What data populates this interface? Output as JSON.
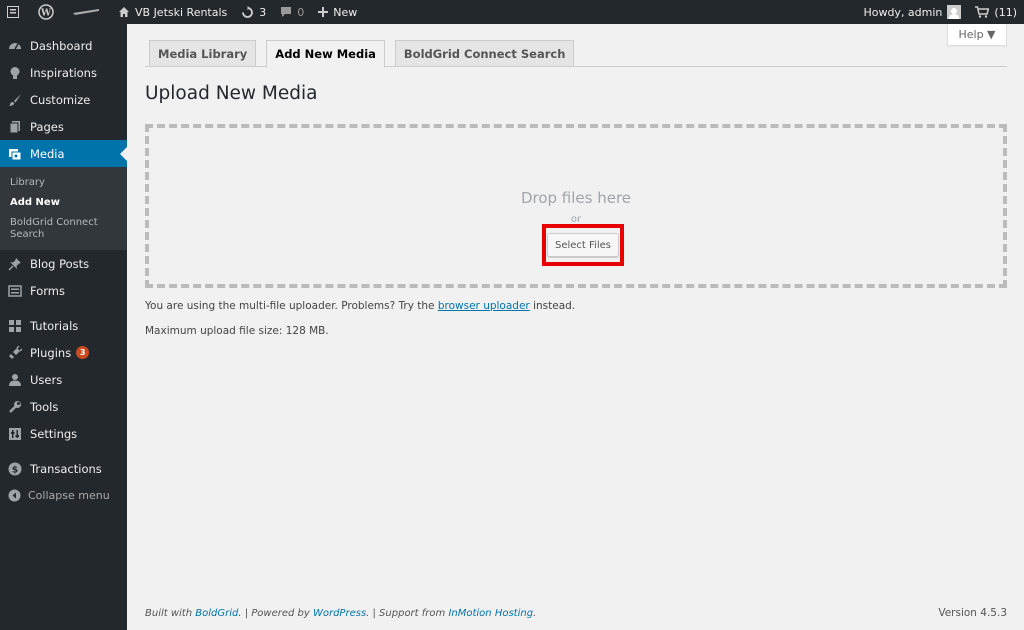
{
  "adminbar": {
    "site_name": "VB Jetski Rentals",
    "updates_count": "3",
    "comments_count": "0",
    "new_label": "New",
    "howdy": "Howdy, admin",
    "cart_count": "(11)"
  },
  "sidebar": {
    "items_top": [
      {
        "label": "Dashboard",
        "icon": "dashboard-icon"
      },
      {
        "label": "Inspirations",
        "icon": "lightbulb-icon"
      },
      {
        "label": "Customize",
        "icon": "brush-icon"
      },
      {
        "label": "Pages",
        "icon": "pages-icon"
      }
    ],
    "media_label": "Media",
    "submenu": [
      "Library",
      "Add New",
      "BoldGrid Connect Search"
    ],
    "items_mid": [
      {
        "label": "Blog Posts",
        "icon": "pushpin-icon"
      },
      {
        "label": "Forms",
        "icon": "forms-icon"
      }
    ],
    "tutorials": "Tutorials",
    "plugins": "Plugins",
    "plugins_badge": "3",
    "users": "Users",
    "tools": "Tools",
    "settings": "Settings",
    "transactions": "Transactions",
    "collapse": "Collapse menu"
  },
  "help_label": "Help ▼",
  "tabs": [
    "Media Library",
    "Add New Media",
    "BoldGrid Connect Search"
  ],
  "page_title": "Upload New Media",
  "dropzone": {
    "drop_text": "Drop files here",
    "or_text": "or",
    "select_button": "Select Files"
  },
  "uploader_note": {
    "before": "You are using the multi-file uploader. Problems? Try the ",
    "link": "browser uploader",
    "after": " instead."
  },
  "max_size": "Maximum upload file size: 128 MB.",
  "footer": {
    "built_with": "Built with ",
    "boldgrid": "BoldGrid",
    "sep1": ". | Powered by ",
    "wordpress": "WordPress",
    "sep2": ". | Support from ",
    "inmotion": "InMotion Hosting",
    "end": ".",
    "version": "Version 4.5.3"
  },
  "colors": {
    "sidebar_bg": "#23282d",
    "accent": "#0073aa",
    "highlight": "#e60000"
  }
}
